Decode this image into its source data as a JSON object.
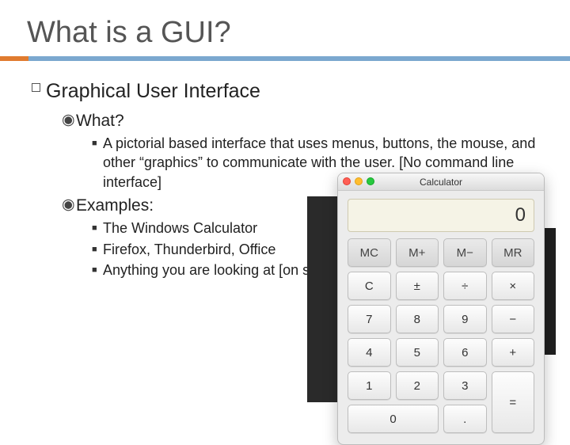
{
  "title": "What is a GUI?",
  "heading": "Graphical User Interface",
  "sub1": "What?",
  "sub1_body": "A pictorial based interface that uses menus, buttons, the mouse, and other “graphics” to communicate with the user. [No command line interface]",
  "sub2": "Examples:",
  "ex1": "The Windows Calculator",
  "ex2": "Firefox, Thunderbird, Office",
  "ex3": "Anything you are looking at [on screen]",
  "calc": {
    "title": "Calculator",
    "display": "0",
    "rows": [
      [
        "MC",
        "M+",
        "M−",
        "MR"
      ],
      [
        "C",
        "±",
        "÷",
        "×"
      ],
      [
        "7",
        "8",
        "9",
        "−"
      ],
      [
        "4",
        "5",
        "6",
        "+"
      ],
      [
        "1",
        "2",
        "3",
        "="
      ],
      [
        "0",
        ".",
        "",
        ""
      ]
    ],
    "btn_mc": "MC",
    "btn_mp": "M+",
    "btn_mm": "M−",
    "btn_mr": "MR",
    "btn_c": "C",
    "btn_pm": "±",
    "btn_div": "÷",
    "btn_mul": "×",
    "btn_7": "7",
    "btn_8": "8",
    "btn_9": "9",
    "btn_sub": "−",
    "btn_4": "4",
    "btn_5": "5",
    "btn_6": "6",
    "btn_add": "+",
    "btn_1": "1",
    "btn_2": "2",
    "btn_3": "3",
    "btn_eq": "=",
    "btn_0": "0",
    "btn_dot": "."
  }
}
